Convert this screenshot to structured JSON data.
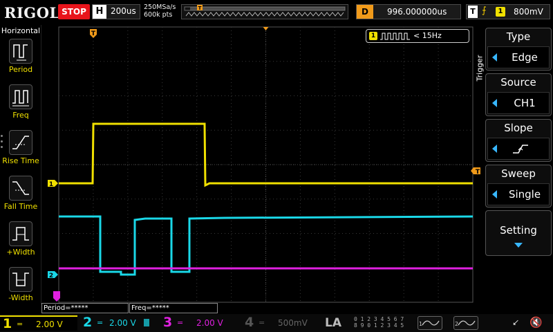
{
  "topbar": {
    "brand": "RIGOL",
    "run_state": "STOP",
    "timebase_key": "H",
    "timebase": "200us",
    "sample_rate": "250MSa/s",
    "memory_depth": "600k pts",
    "trigger_delay_key": "D",
    "trigger_delay": "996.000000us",
    "trigger_key": "T",
    "trigger_source_badge": "1",
    "trigger_level": "800mV"
  },
  "left_menu": {
    "title": "Horizontal",
    "items": [
      {
        "label": "Period",
        "icon": "period-icon"
      },
      {
        "label": "Freq",
        "icon": "frequency-icon"
      },
      {
        "label": "Rise Time",
        "icon": "rise-time-icon"
      },
      {
        "label": "Fall Time",
        "icon": "fall-time-icon"
      },
      {
        "label": "+Width",
        "icon": "positive-width-icon"
      },
      {
        "label": "-Width",
        "icon": "negative-width-icon"
      }
    ]
  },
  "scope": {
    "freq_channel": "1",
    "freq_readout": "< 15Hz",
    "trigger_marker": "T",
    "ch1_marker": "1",
    "ch2_marker": "2",
    "level_marker": "T",
    "colors": {
      "ch1": "#f0e000",
      "ch2": "#1ad8e8",
      "ch3": "#e020e0",
      "ch4": "#2060ff",
      "trigger": "#f09a1a",
      "grid": "#3a3a3a"
    }
  },
  "measurements": [
    {
      "text": "Period=*****"
    },
    {
      "text": "Freq=*****"
    }
  ],
  "right_menu": {
    "section_label": "Trigger",
    "items": [
      {
        "head": "Type",
        "value": "Edge"
      },
      {
        "head": "Source",
        "value": "CH1"
      },
      {
        "head": "Slope",
        "value": ""
      },
      {
        "head": "Sweep",
        "value": "Single"
      }
    ],
    "setting": "Setting"
  },
  "bottombar": {
    "channels": [
      {
        "num": "1",
        "coupling": "=",
        "volts": "2.00 V",
        "color": "#f0e000"
      },
      {
        "num": "2",
        "coupling": "=",
        "volts": "2.00 V",
        "color": "#1ad8e8"
      },
      {
        "num": "3",
        "coupling": "=",
        "volts": "2.00 V",
        "color": "#e020e0"
      },
      {
        "num": "4",
        "coupling": "=",
        "volts": "500mV",
        "color": "#555555"
      }
    ],
    "la_label": "LA",
    "la_bits_top": "0 1 2 3  4 5 6 7",
    "la_bits_bottom": "8 9 0 1  2 3 4 5",
    "generator_1": "1",
    "generator_2": "2"
  }
}
